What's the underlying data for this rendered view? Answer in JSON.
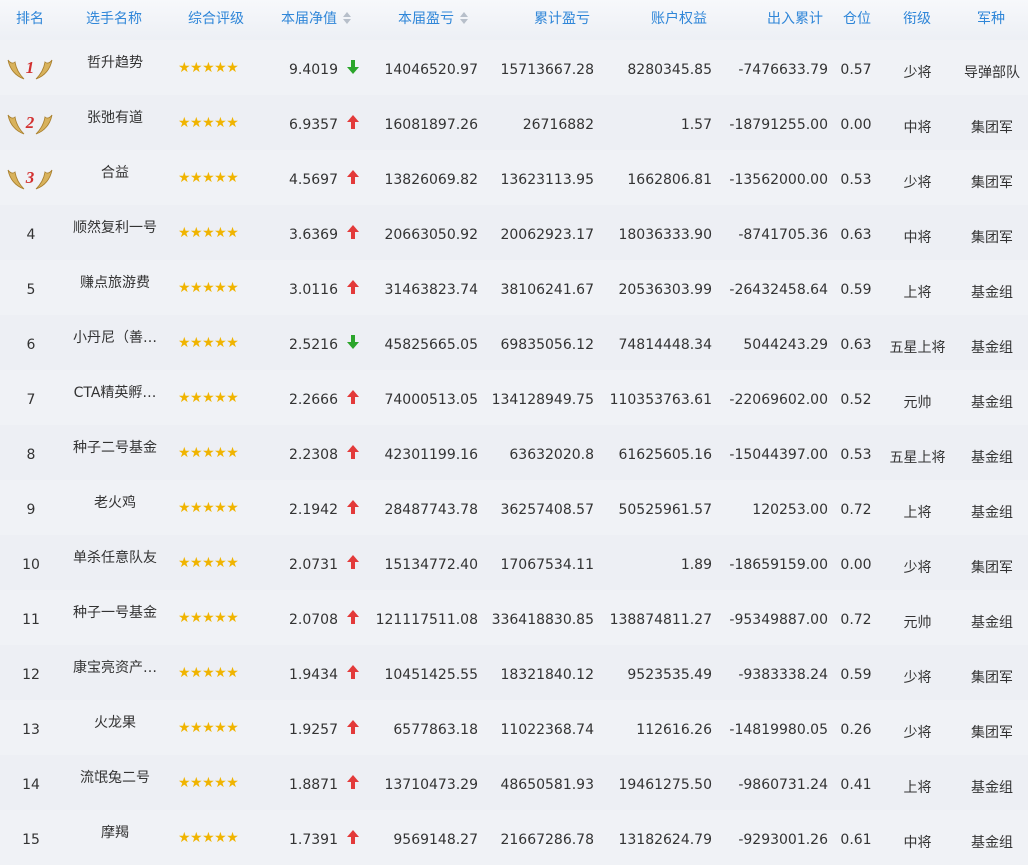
{
  "columns": {
    "rank": "排名",
    "name": "选手名称",
    "rating": "综合评级",
    "nav": "本届净值",
    "current_pnl": "本届盈亏",
    "cumulative_pnl": "累计盈亏",
    "equity": "账户权益",
    "inout": "出入累计",
    "position": "仓位",
    "level": "衔级",
    "arm": "军种"
  },
  "colors": {
    "header_text": "#2f86d8",
    "star": "#f0b400",
    "up": "#e33a3a",
    "down": "#2ba52b",
    "medal": "#d8b25c",
    "medal_num": "#d23030"
  },
  "rows": [
    {
      "rank": "1",
      "medal": true,
      "name": "哲升趋势",
      "stars": "★★★★★",
      "nav": "9.4019",
      "trend": "down",
      "current": "14046520.97",
      "cumulative": "15713667.28",
      "equity": "8280345.85",
      "inout": "-7476633.79",
      "position": "0.57",
      "level": "少将",
      "arm": "导弹部队"
    },
    {
      "rank": "2",
      "medal": true,
      "name": "张弛有道",
      "stars": "★★★★★",
      "nav": "6.9357",
      "trend": "up",
      "current": "16081897.26",
      "cumulative": "26716882",
      "equity": "1.57",
      "inout": "-18791255.00",
      "position": "0.00",
      "level": "中将",
      "arm": "集团军"
    },
    {
      "rank": "3",
      "medal": true,
      "name": "合益",
      "stars": "★★★★★",
      "nav": "4.5697",
      "trend": "up",
      "current": "13826069.82",
      "cumulative": "13623113.95",
      "equity": "1662806.81",
      "inout": "-13562000.00",
      "position": "0.53",
      "level": "少将",
      "arm": "集团军"
    },
    {
      "rank": "4",
      "medal": false,
      "name": "顺然复利一号",
      "stars": "★★★★★",
      "nav": "3.6369",
      "trend": "up",
      "current": "20663050.92",
      "cumulative": "20062923.17",
      "equity": "18036333.90",
      "inout": "-8741705.36",
      "position": "0.63",
      "level": "中将",
      "arm": "集团军"
    },
    {
      "rank": "5",
      "medal": false,
      "name": "赚点旅游费",
      "stars": "★★★★★",
      "nav": "3.0116",
      "trend": "up",
      "current": "31463823.74",
      "cumulative": "38106241.67",
      "equity": "20536303.99",
      "inout": "-26432458.64",
      "position": "0.59",
      "level": "上将",
      "arm": "基金组"
    },
    {
      "rank": "6",
      "medal": false,
      "name": "小丹尼（善…",
      "stars": "★★★★★",
      "nav": "2.5216",
      "trend": "down",
      "current": "45825665.05",
      "cumulative": "69835056.12",
      "equity": "74814448.34",
      "inout": "5044243.29",
      "position": "0.63",
      "level": "五星上将",
      "arm": "基金组"
    },
    {
      "rank": "7",
      "medal": false,
      "name": "CTA精英孵…",
      "stars": "★★★★★",
      "nav": "2.2666",
      "trend": "up",
      "current": "74000513.05",
      "cumulative": "134128949.75",
      "equity": "110353763.61",
      "inout": "-22069602.00",
      "position": "0.52",
      "level": "元帅",
      "arm": "基金组"
    },
    {
      "rank": "8",
      "medal": false,
      "name": "种子二号基金",
      "stars": "★★★★★",
      "nav": "2.2308",
      "trend": "up",
      "current": "42301199.16",
      "cumulative": "63632020.8",
      "equity": "61625605.16",
      "inout": "-15044397.00",
      "position": "0.53",
      "level": "五星上将",
      "arm": "基金组"
    },
    {
      "rank": "9",
      "medal": false,
      "name": "老火鸡",
      "stars": "★★★★★",
      "nav": "2.1942",
      "trend": "up",
      "current": "28487743.78",
      "cumulative": "36257408.57",
      "equity": "50525961.57",
      "inout": "120253.00",
      "position": "0.72",
      "level": "上将",
      "arm": "基金组"
    },
    {
      "rank": "10",
      "medal": false,
      "name": "单杀任意队友",
      "stars": "★★★★★",
      "nav": "2.0731",
      "trend": "up",
      "current": "15134772.40",
      "cumulative": "17067534.11",
      "equity": "1.89",
      "inout": "-18659159.00",
      "position": "0.00",
      "level": "少将",
      "arm": "集团军"
    },
    {
      "rank": "11",
      "medal": false,
      "name": "种子一号基金",
      "stars": "★★★★★",
      "nav": "2.0708",
      "trend": "up",
      "current": "121117511.08",
      "cumulative": "336418830.85",
      "equity": "138874811.27",
      "inout": "-95349887.00",
      "position": "0.72",
      "level": "元帅",
      "arm": "基金组"
    },
    {
      "rank": "12",
      "medal": false,
      "name": "康宝亮资产…",
      "stars": "★★★★★",
      "nav": "1.9434",
      "trend": "up",
      "current": "10451425.55",
      "cumulative": "18321840.12",
      "equity": "9523535.49",
      "inout": "-9383338.24",
      "position": "0.59",
      "level": "少将",
      "arm": "集团军"
    },
    {
      "rank": "13",
      "medal": false,
      "name": "火龙果",
      "stars": "★★★★★",
      "nav": "1.9257",
      "trend": "up",
      "current": "6577863.18",
      "cumulative": "11022368.74",
      "equity": "112616.26",
      "inout": "-14819980.05",
      "position": "0.26",
      "level": "少将",
      "arm": "集团军"
    },
    {
      "rank": "14",
      "medal": false,
      "name": "流氓兔二号",
      "stars": "★★★★★",
      "nav": "1.8871",
      "trend": "up",
      "current": "13710473.29",
      "cumulative": "48650581.93",
      "equity": "19461275.50",
      "inout": "-9860731.24",
      "position": "0.41",
      "level": "上将",
      "arm": "基金组"
    },
    {
      "rank": "15",
      "medal": false,
      "name": "摩羯",
      "stars": "★★★★★",
      "nav": "1.7391",
      "trend": "up",
      "current": "9569148.27",
      "cumulative": "21667286.78",
      "equity": "13182624.79",
      "inout": "-9293001.26",
      "position": "0.61",
      "level": "中将",
      "arm": "基金组"
    }
  ]
}
